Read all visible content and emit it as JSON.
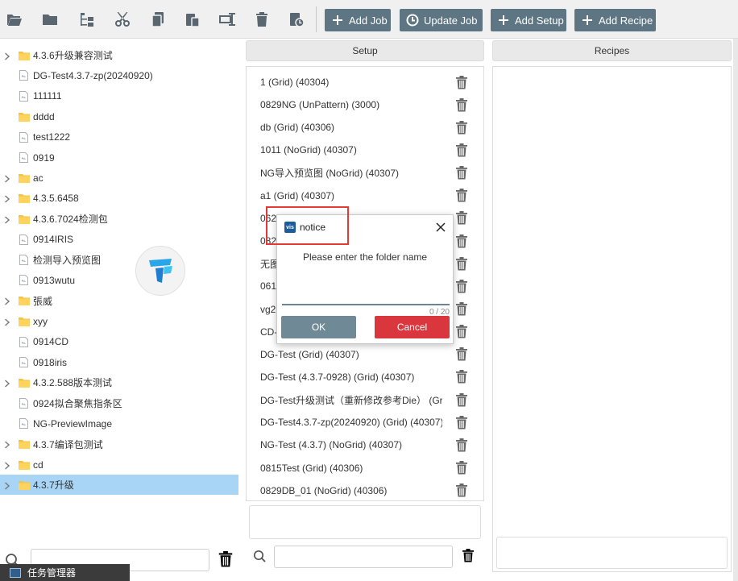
{
  "toolbar": {
    "icons": [
      "open-folder-icon",
      "folder-icon",
      "tree-structure-icon",
      "cut-icon",
      "copy-icon",
      "paste-icon",
      "rename-icon",
      "delete-icon",
      "history-icon"
    ],
    "buttons": {
      "add_job": "Add Job",
      "update_job": "Update Job",
      "add_setup": "Add Setup",
      "add_recipe": "Add Recipe"
    },
    "button_color": "#5e7683"
  },
  "tree": {
    "items": [
      {
        "label": "4.3.6升级兼容测试",
        "type": "folder"
      },
      {
        "label": "DG-Test4.3.7-zp(20240920)",
        "type": "file"
      },
      {
        "label": "111111",
        "type": "file"
      },
      {
        "label": "dddd",
        "type": "folder-leaf"
      },
      {
        "label": "test1222",
        "type": "file"
      },
      {
        "label": "0919",
        "type": "file"
      },
      {
        "label": "ac",
        "type": "folder"
      },
      {
        "label": "4.3.5.6458",
        "type": "folder"
      },
      {
        "label": "4.3.6.7024检测包",
        "type": "folder"
      },
      {
        "label": "0914IRIS",
        "type": "file"
      },
      {
        "label": "检测导入预览图",
        "type": "file"
      },
      {
        "label": "0913wutu",
        "type": "file"
      },
      {
        "label": "張威",
        "type": "folder"
      },
      {
        "label": "xyy",
        "type": "folder"
      },
      {
        "label": "0914CD",
        "type": "file"
      },
      {
        "label": "0918iris",
        "type": "file"
      },
      {
        "label": "4.3.2.588版本测试",
        "type": "folder"
      },
      {
        "label": "0924拟合聚焦指条区",
        "type": "file"
      },
      {
        "label": "NG-PreviewImage",
        "type": "file"
      },
      {
        "label": "4.3.7编译包测试",
        "type": "folder"
      },
      {
        "label": "cd",
        "type": "folder"
      },
      {
        "label": "4.3.7升级",
        "type": "folder",
        "selected": true
      }
    ],
    "selected_color": "#a8d4f6"
  },
  "columns": {
    "setup_header": "Setup",
    "recipes_header": "Recipes"
  },
  "setups": [
    "1 (Grid) (40304)",
    "0829NG (UnPattern) (3000)",
    "db (Grid) (40306)",
    "1011 (NoGrid) (40307)",
    "NG导入预览图 (NoGrid) (40307)",
    "a1 (Grid) (40307)",
    "0626_DG (Grid) (40306)",
    "0829",
    "无图",
    "061",
    "vg2",
    "CD-",
    "DG-Test (Grid) (40307)",
    "DG-Test  (4.3.7-0928)   (Grid) (40307)",
    "DG-Test升级测试（重新修改参考Die） (Grid",
    "DG-Test4.3.7-zp(20240920) (Grid) (40307)",
    "NG-Test  (4.3.7)    (NoGrid) (40307)",
    "0815Test (Grid) (40306)",
    "0829DB_01 (NoGrid) (40306)"
  ],
  "dialog": {
    "app_icon_text": "vis",
    "title": "notice",
    "message": "Please enter the folder name",
    "input_value": "",
    "counter": "0 / 20",
    "ok_label": "OK",
    "cancel_label": "Cancel",
    "ok_color": "#6f8a96",
    "cancel_color": "#d9363e"
  },
  "taskbar": {
    "label": "任务管理器"
  }
}
